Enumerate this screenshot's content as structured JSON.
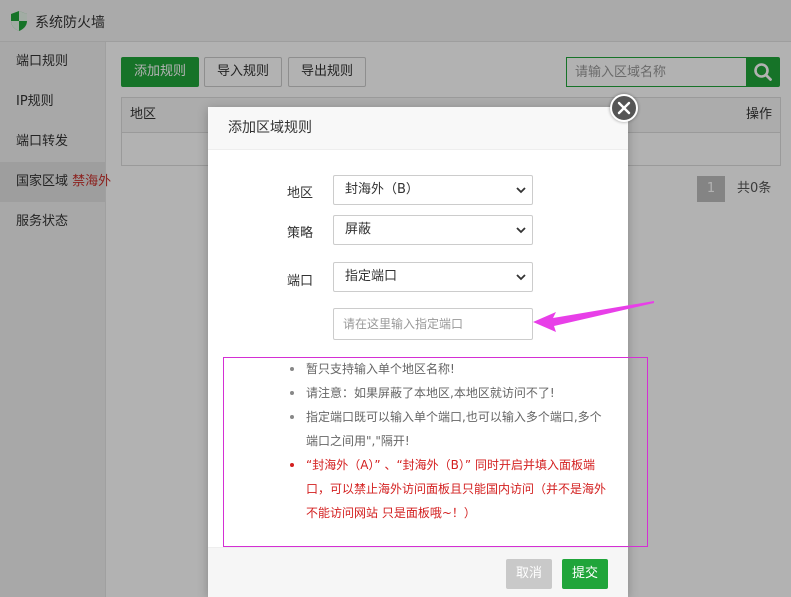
{
  "app": {
    "title": "系统防火墙"
  },
  "sidebar": {
    "items": [
      {
        "label": "端口规则"
      },
      {
        "label": "IP规则"
      },
      {
        "label": "端口转发"
      },
      {
        "label": "国家区域",
        "badge": "禁海外"
      },
      {
        "label": "服务状态"
      }
    ]
  },
  "toolbar": {
    "add_label": "添加规则",
    "import_label": "导入规则",
    "export_label": "导出规则",
    "search_placeholder": "请输入区域名称"
  },
  "table": {
    "columns": [
      "地区",
      "操作"
    ]
  },
  "pager": {
    "page": "1",
    "total": "共0条"
  },
  "dialog": {
    "title": "添加区域规则",
    "region_label": "地区",
    "region_value": "封海外（B）",
    "policy_label": "策略",
    "policy_value": "屏蔽",
    "port_label": "端口",
    "port_value": "指定端口",
    "port_placeholder": "请在这里输入指定端口",
    "tips": [
      "暂只支持输入单个地区名称!",
      "请注意：如果屏蔽了本地区,本地区就访问不了!",
      "指定端口既可以输入单个端口,也可以输入多个端口,多个端口之间用\",\"隔开!"
    ],
    "warning": "“封海外（A）” 、“封海外（B）” 同时开启并填入面板端口，可以禁止海外访问面板且只能国内访问（并不是海外不能访问网站 只是面板哦~！）",
    "cancel_label": "取消",
    "submit_label": "提交"
  },
  "colors": {
    "brand_green": "#20a53a",
    "annotation_magenta": "#d42fd4",
    "warning_red": "#d31f1f"
  }
}
